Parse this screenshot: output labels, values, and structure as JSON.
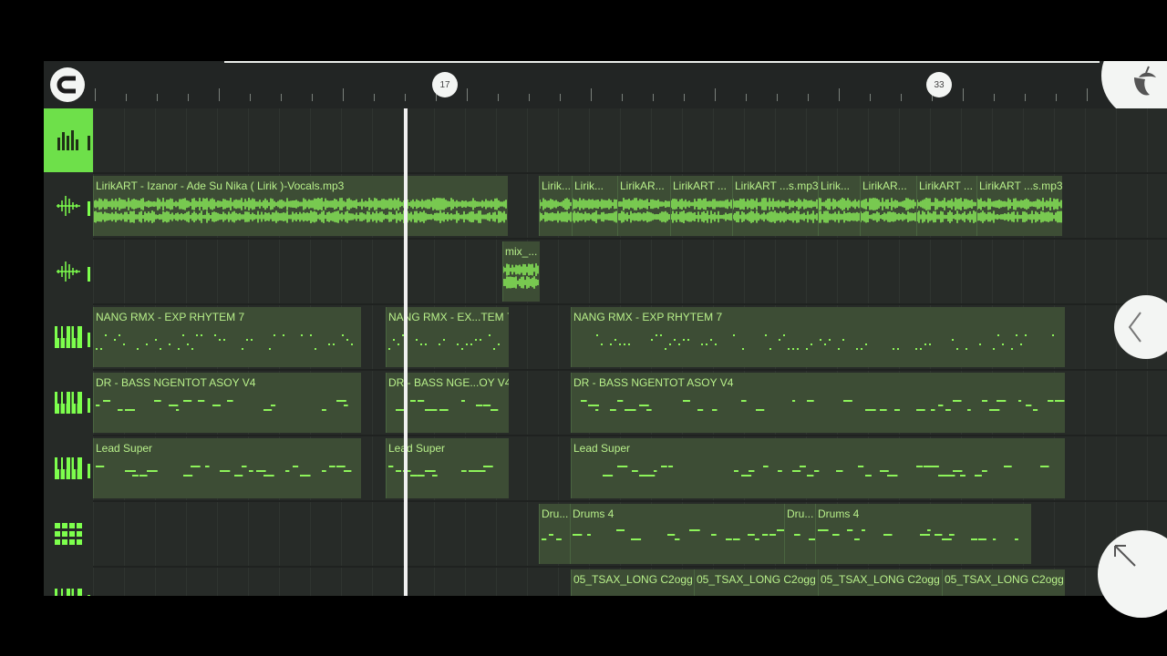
{
  "ruler": {
    "bar_labels": [
      "17",
      "33"
    ]
  },
  "colors": {
    "accent": "#6ee04a",
    "clip": "#3d4d35",
    "clip_text": "#b8f08a",
    "waveform": "#8df35a"
  },
  "icons": {
    "snap": "magnet-icon",
    "app_logo": "fl-fruit-logo",
    "audio_track": "audio-wave-icon",
    "piano_track": "piano-keys-icon",
    "drum_track": "step-grid-icon",
    "collapse": "chevron-left-icon",
    "expand": "arrow-up-left-icon"
  },
  "tracks": [
    {
      "type": "mixer",
      "clips": []
    },
    {
      "type": "audio",
      "clips": [
        {
          "title": "LirikART - Izanor - Ade Su Nika ( Lirik )-Vocals.mp3"
        },
        {
          "title": "Lirik..."
        },
        {
          "title": "Lirik..."
        },
        {
          "title": "LirikAR..."
        },
        {
          "title": "LirikART ..."
        },
        {
          "title": "LirikART ...s.mp3"
        },
        {
          "title": "Lirik..."
        },
        {
          "title": "LirikAR..."
        },
        {
          "title": "LirikART ..."
        },
        {
          "title": "LirikART ...s.mp3"
        }
      ]
    },
    {
      "type": "audio",
      "clips": [
        {
          "title": "mix_..."
        }
      ]
    },
    {
      "type": "piano",
      "clips": [
        {
          "title": "NANG RMX - EXP RHYTEM 7"
        },
        {
          "title": "NANG RMX - EX...TEM 7"
        },
        {
          "title": "NANG RMX - EXP RHYTEM 7"
        }
      ]
    },
    {
      "type": "piano",
      "clips": [
        {
          "title": "DR - BASS NGENTOT ASOY V4"
        },
        {
          "title": "DR - BASS NGE...OY V4"
        },
        {
          "title": "DR - BASS NGENTOT ASOY V4"
        }
      ]
    },
    {
      "type": "piano",
      "clips": [
        {
          "title": "Lead Super"
        },
        {
          "title": "Lead Super"
        },
        {
          "title": "Lead Super"
        }
      ]
    },
    {
      "type": "drum",
      "clips": [
        {
          "title": "Dru..."
        },
        {
          "title": "Drums 4"
        },
        {
          "title": "Dru..."
        },
        {
          "title": "Drums 4"
        }
      ]
    },
    {
      "type": "piano",
      "clips": [
        {
          "title": "05_TSAX_LONG C2ogg"
        },
        {
          "title": "05_TSAX_LONG C2ogg"
        },
        {
          "title": "05_TSAX_LONG C2ogg"
        },
        {
          "title": "05_TSAX_LONG C2ogg"
        }
      ]
    }
  ]
}
